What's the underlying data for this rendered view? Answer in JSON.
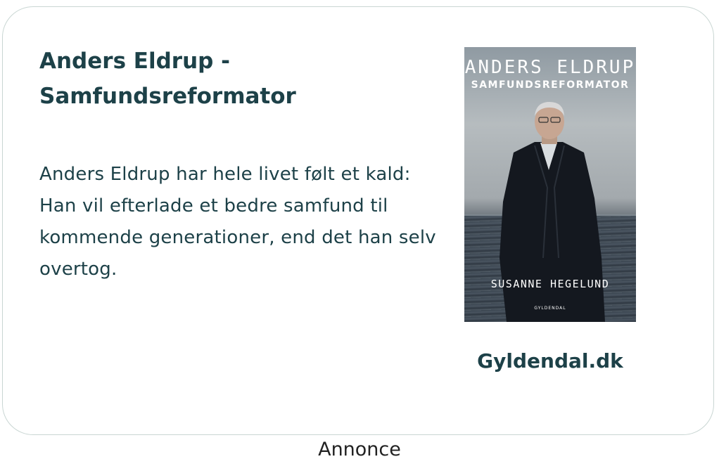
{
  "ad": {
    "title": "Anders Eldrup - Samfundsreformator",
    "description": "Anders Eldrup har hele livet følt et kald: Han vil efterlade et bedre samfund til kommende generationer, end det han selv overtog.",
    "publisher_link": "Gyldendal.dk",
    "label": "Annonce"
  },
  "book_cover": {
    "author_line": "ANDERS ELDRUP",
    "title_line": "SAMFUNDSREFORMATOR",
    "writer_line": "SUSANNE HEGELUND",
    "publisher_line": "GYLDENDAL"
  }
}
